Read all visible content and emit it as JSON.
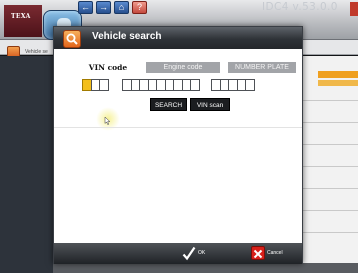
{
  "app": {
    "logo_text": "TEXA",
    "version_label": "IDC4 v.53.0.0",
    "breadcrumb": "Vehicle se",
    "nav": {
      "back_glyph": "←",
      "forward_glyph": "→",
      "home_glyph": "⌂",
      "help_glyph": "?"
    },
    "colors": {
      "accent": "#e2661c",
      "vin_active": "#f3bf1b",
      "tab_inactive": "#a2a4a8"
    }
  },
  "dialog": {
    "title": "Vehicle search",
    "tabs": [
      {
        "label": "VIN code",
        "selected": true
      },
      {
        "label": "Engine code",
        "selected": false
      },
      {
        "label": "NUMBER PLATE",
        "selected": false
      }
    ],
    "vin_input": {
      "groups": [
        3,
        9,
        5
      ],
      "value": "",
      "active_box": 1
    },
    "buttons": {
      "search": "SEARCH",
      "vin_scan": "VIN scan"
    },
    "footer": {
      "ok_label": "OK",
      "cancel_label": "Cancel"
    }
  }
}
